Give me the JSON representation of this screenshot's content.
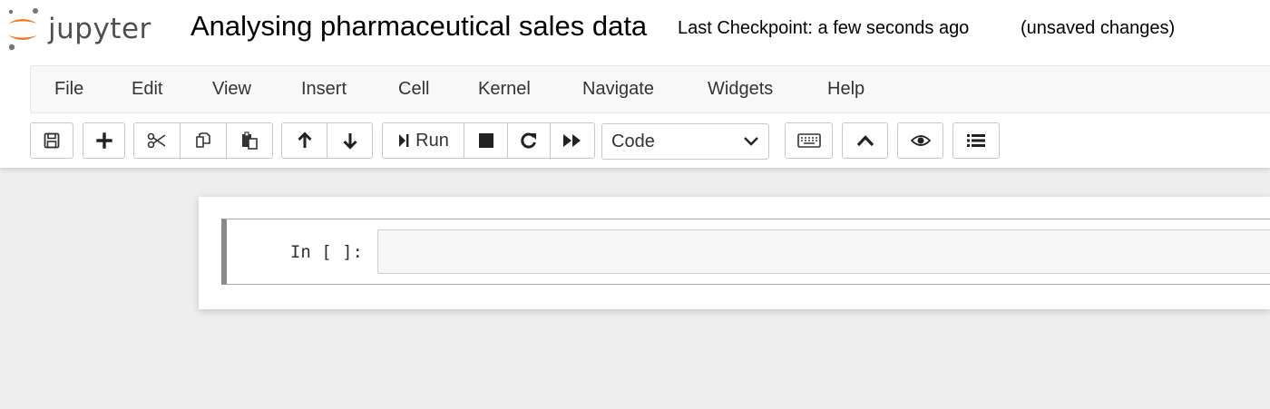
{
  "header": {
    "logo_text": "jupyter",
    "notebook_title": "Analysing pharmaceutical sales data",
    "checkpoint_text": "Last Checkpoint: a few seconds ago",
    "unsaved_text": "(unsaved changes)"
  },
  "menubar": {
    "items": [
      "File",
      "Edit",
      "View",
      "Insert",
      "Cell",
      "Kernel",
      "Navigate",
      "Widgets",
      "Help"
    ]
  },
  "toolbar": {
    "run_label": "Run",
    "cell_type": {
      "selected": "Code"
    },
    "icons": [
      "save-icon",
      "plus-icon",
      "cut-icon",
      "copy-icon",
      "paste-icon",
      "arrow-up-icon",
      "arrow-down-icon",
      "step-run-icon",
      "stop-icon",
      "restart-icon",
      "fast-forward-icon",
      "chevron-down-icon",
      "keyboard-icon",
      "chevron-up-icon",
      "eye-icon",
      "list-icon"
    ]
  },
  "cell": {
    "prompt": "In [ ]:",
    "source": ""
  },
  "colors": {
    "jupyter_orange": "#f37726",
    "page_background": "#eeeeee",
    "cell_border_left": "#8a8a8a"
  }
}
